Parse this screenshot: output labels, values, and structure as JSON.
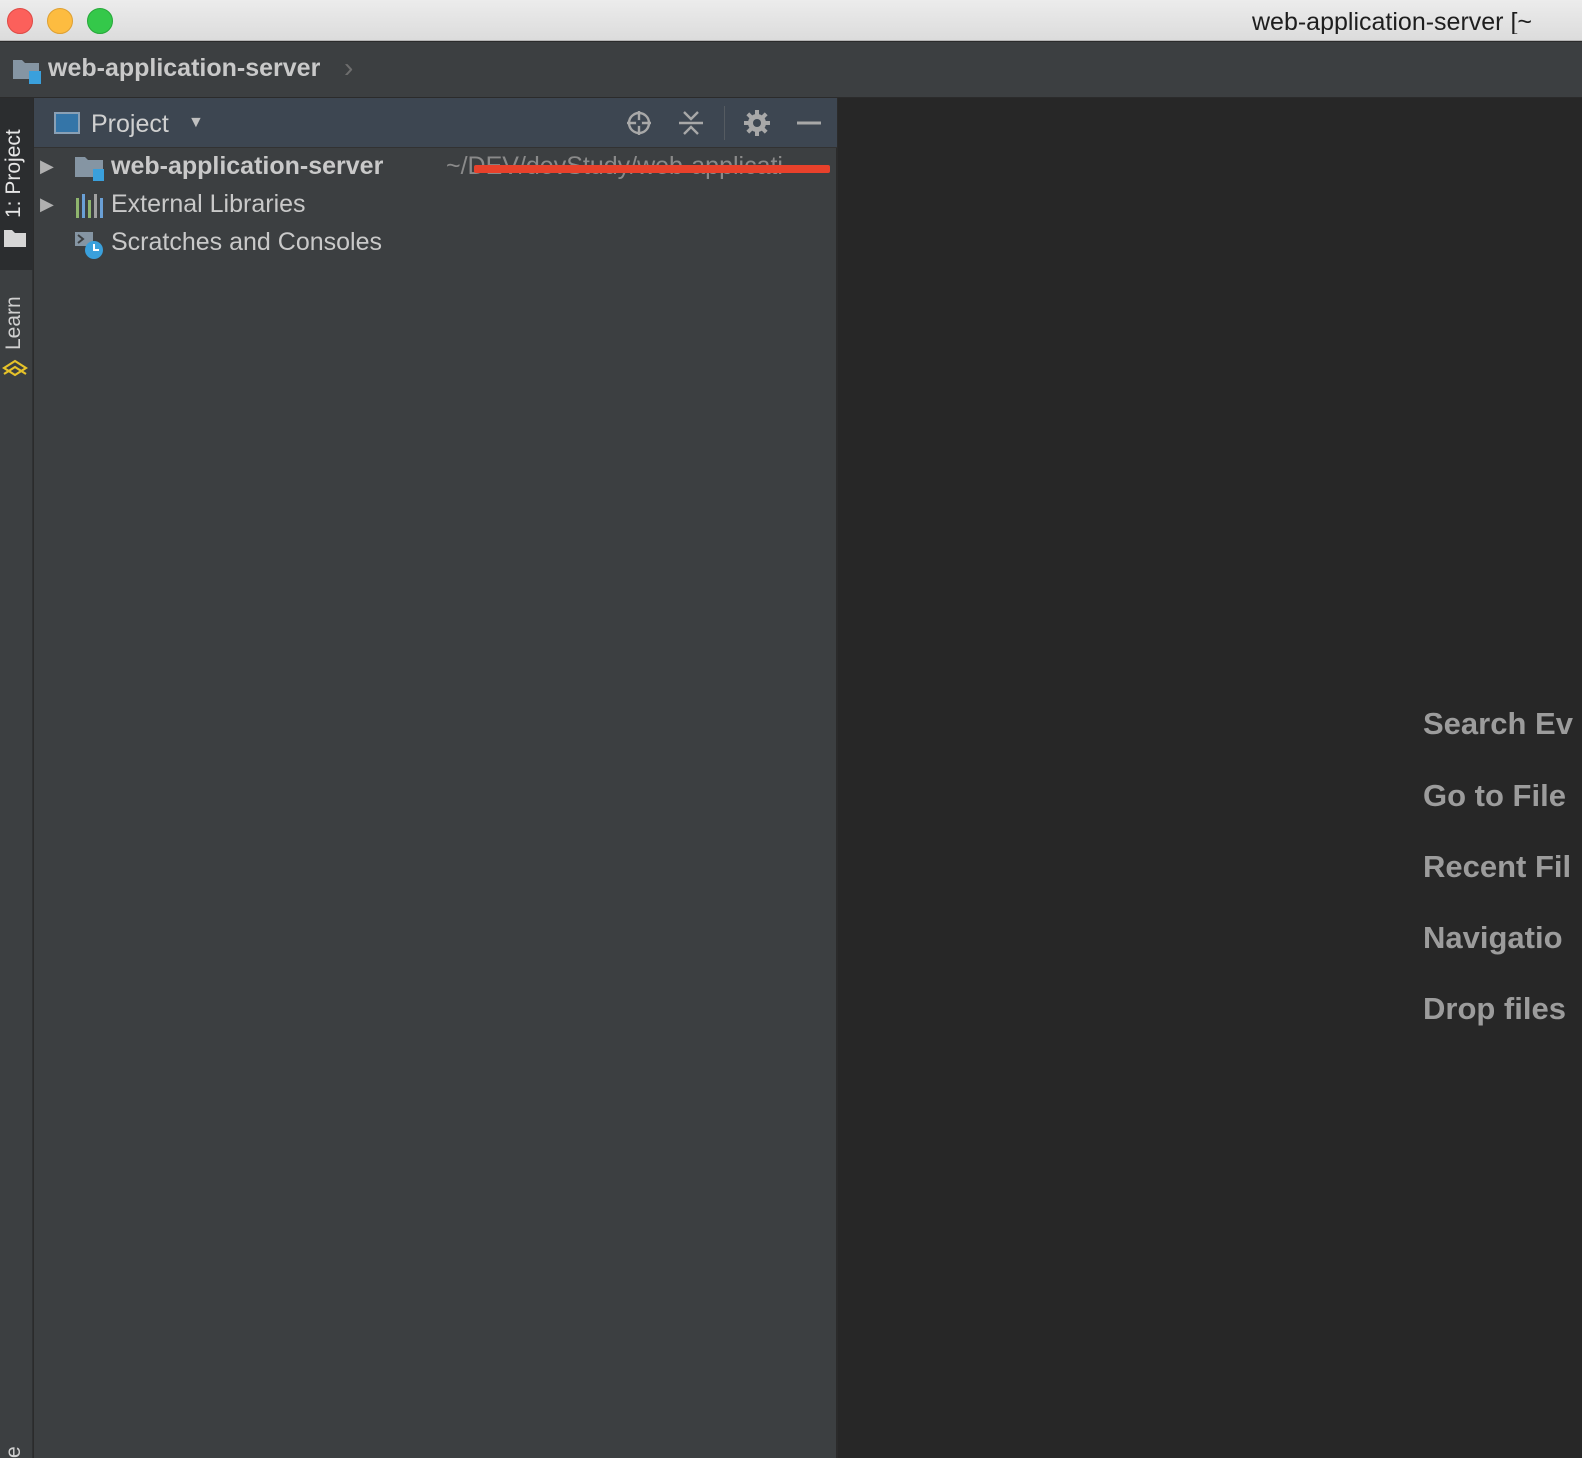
{
  "window": {
    "title": "web-application-server [~"
  },
  "navbar": {
    "breadcrumb": "web-application-server"
  },
  "left_strip": {
    "project_tab": "1: Project",
    "learn_tab": "Learn",
    "bottom_tab": "e"
  },
  "project_panel": {
    "title": "Project",
    "tree": [
      {
        "label": "web-application-server",
        "path": "~/DEV/devStudy/web-applicati"
      },
      {
        "label": "External Libraries"
      },
      {
        "label": "Scratches and Consoles"
      }
    ]
  },
  "editor": {
    "hints": [
      "Search Ev",
      "Go to File",
      "Recent Fil",
      "Navigatio",
      "Drop files"
    ]
  },
  "colors": {
    "accent_blue": "#3aa0dc",
    "redaction": "#e8412b",
    "learn_yellow": "#e6c229"
  }
}
